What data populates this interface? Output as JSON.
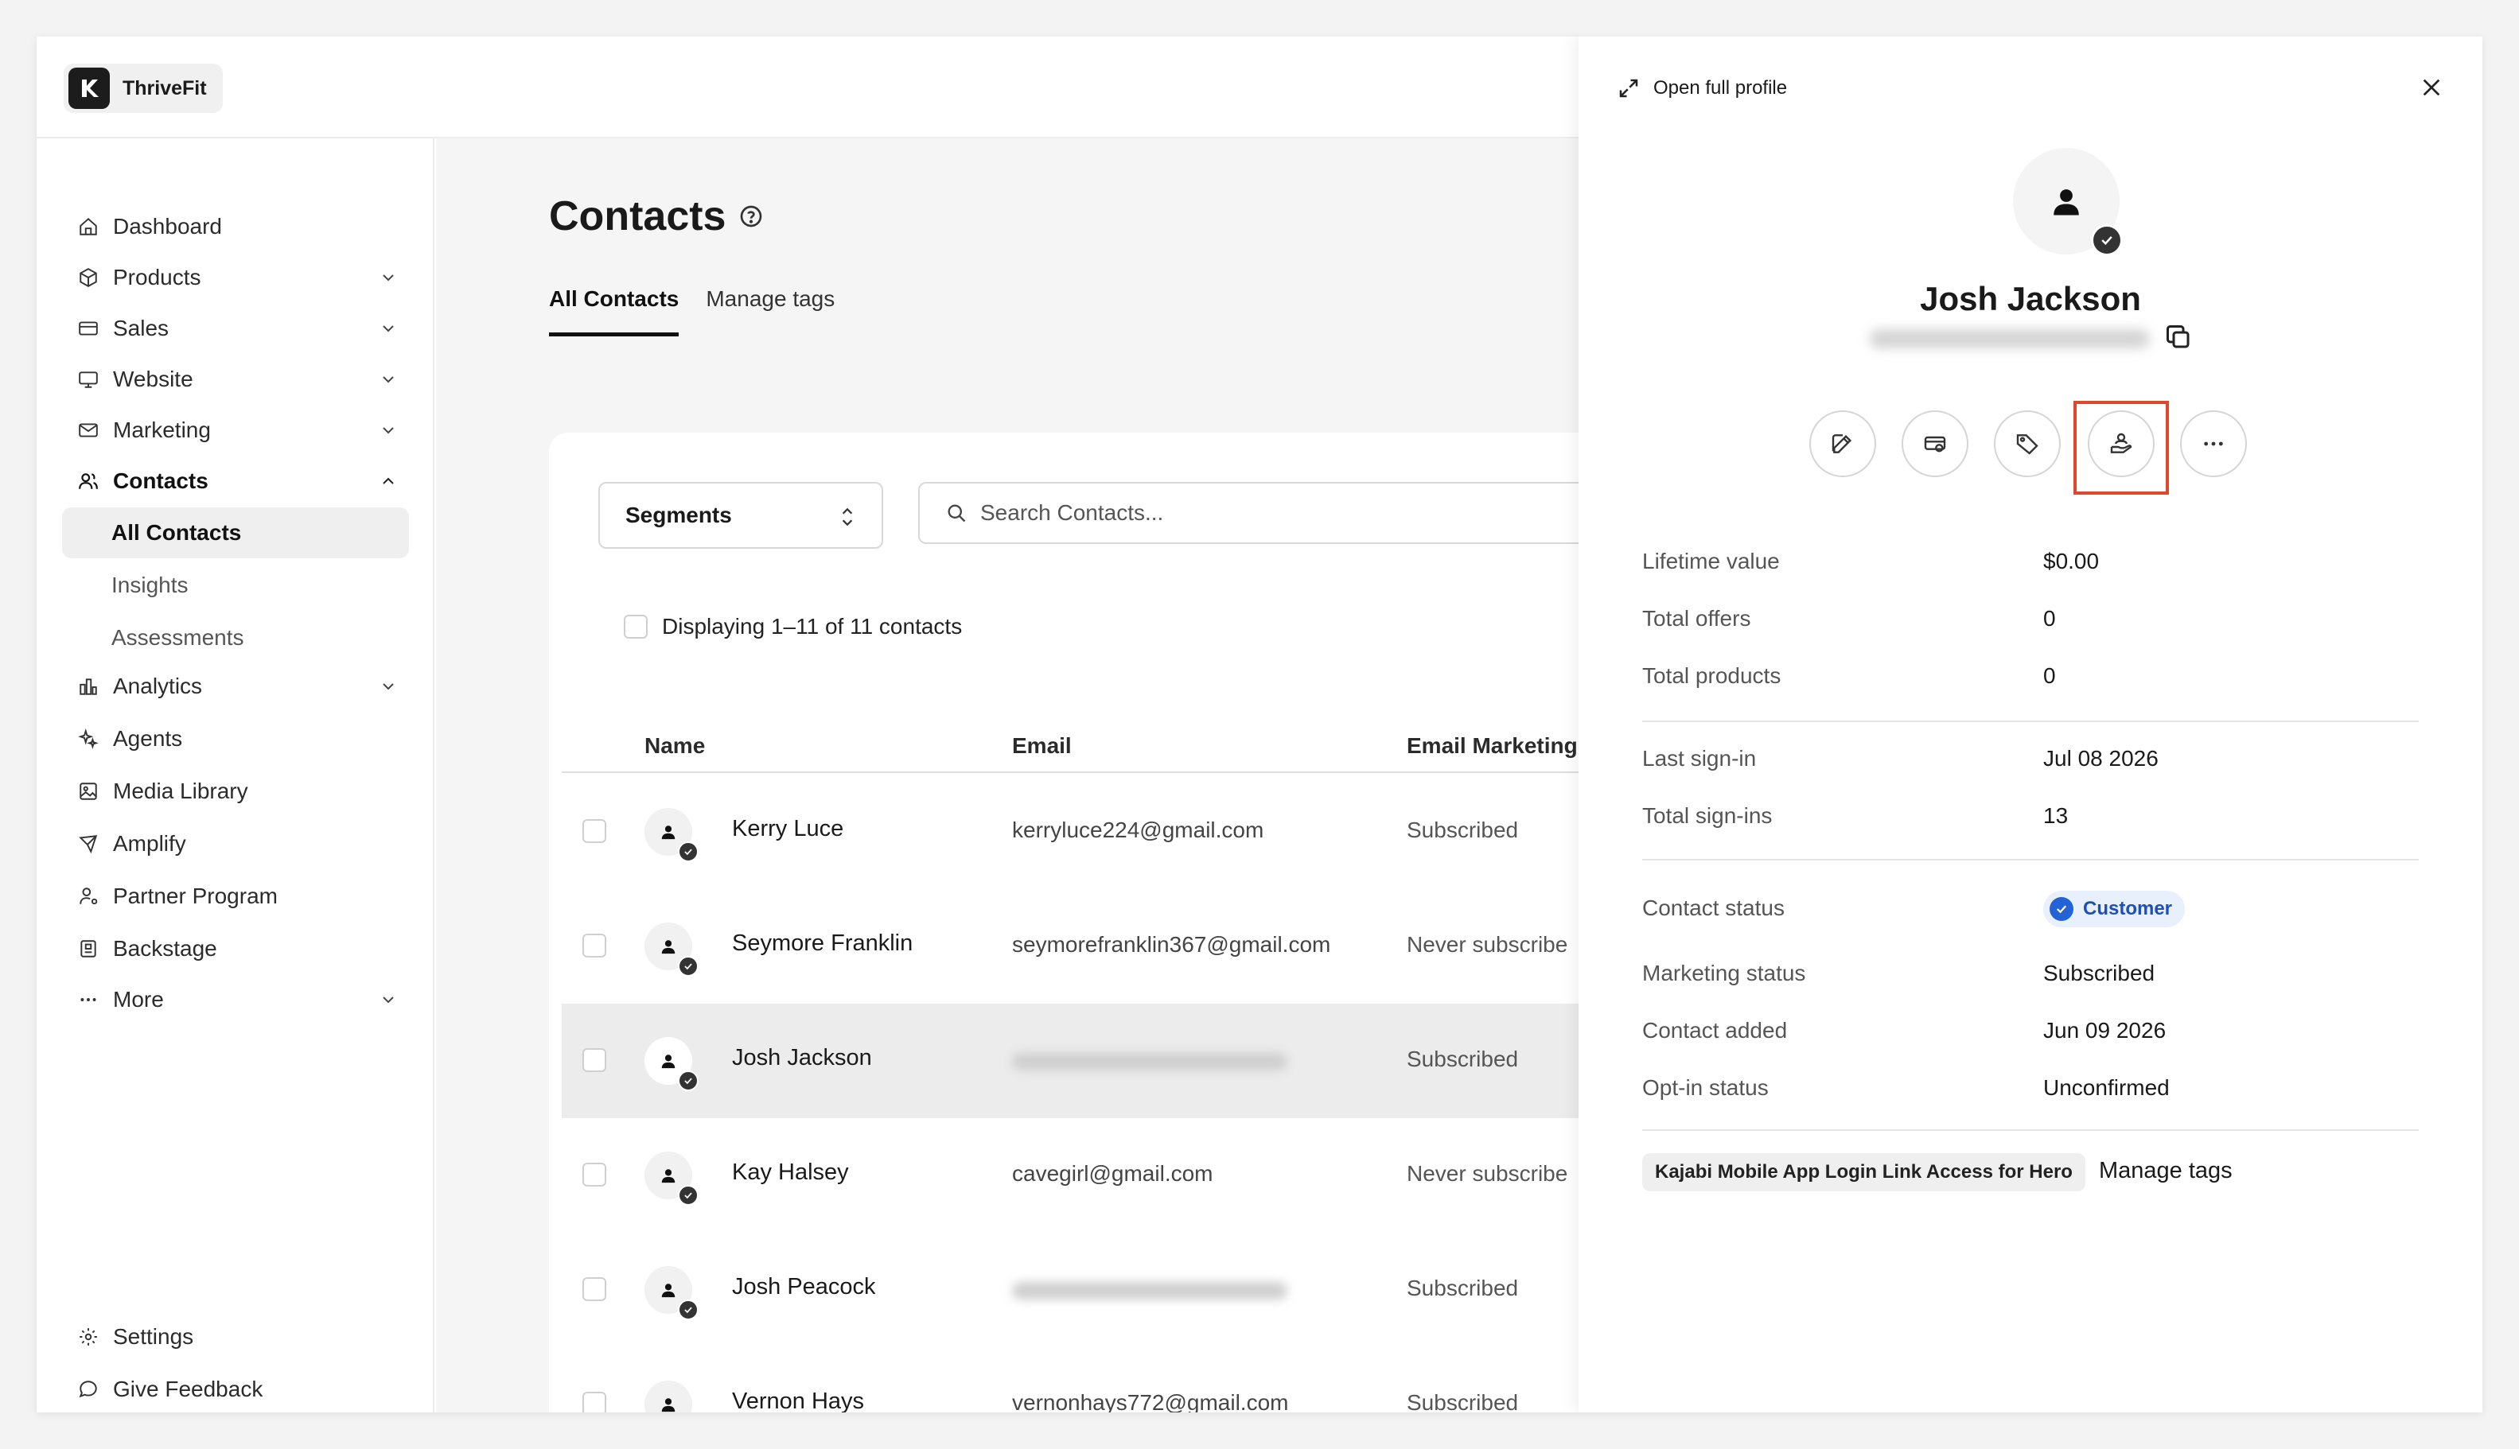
{
  "brand": {
    "name": "ThriveFit"
  },
  "sidebar": {
    "items": [
      {
        "label": "Dashboard",
        "icon": "home-icon",
        "chevron": false
      },
      {
        "label": "Products",
        "icon": "box-icon",
        "chevron": true
      },
      {
        "label": "Sales",
        "icon": "card-icon",
        "chevron": true
      },
      {
        "label": "Website",
        "icon": "monitor-icon",
        "chevron": true
      },
      {
        "label": "Marketing",
        "icon": "mail-icon",
        "chevron": true
      },
      {
        "label": "Contacts",
        "icon": "users-icon",
        "chevron": true,
        "expanded": true
      }
    ],
    "contacts_sub": [
      "All Contacts",
      "Insights",
      "Assessments"
    ],
    "items2": [
      {
        "label": "Analytics",
        "icon": "bar-chart-icon",
        "chevron": true
      },
      {
        "label": "Agents",
        "icon": "sparkle-icon",
        "chevron": false
      },
      {
        "label": "Media Library",
        "icon": "image-icon",
        "chevron": false
      },
      {
        "label": "Amplify",
        "icon": "megaphone-icon",
        "chevron": false
      },
      {
        "label": "Partner Program",
        "icon": "partner-icon",
        "chevron": false
      },
      {
        "label": "Backstage",
        "icon": "backstage-icon",
        "chevron": false
      },
      {
        "label": "More",
        "icon": "more-icon",
        "chevron": true
      }
    ],
    "bottom": [
      {
        "label": "Settings",
        "icon": "gear-icon"
      },
      {
        "label": "Give Feedback",
        "icon": "chat-icon"
      }
    ]
  },
  "main": {
    "title": "Contacts",
    "tabs": [
      "All Contacts",
      "Manage tags"
    ],
    "segments_label": "Segments",
    "search_placeholder": "Search Contacts...",
    "displaying": "Displaying 1–11 of 11 contacts",
    "columns": [
      "Name",
      "Email",
      "Email Marketing"
    ],
    "rows": [
      {
        "name": "Kerry Luce",
        "email": "kerryluce224@gmail.com",
        "marketing": "Subscribed",
        "email_hidden": false
      },
      {
        "name": "Seymore Franklin",
        "email": "seymorefranklin367@gmail.com",
        "marketing": "Never subscribe",
        "email_hidden": false
      },
      {
        "name": "Josh Jackson",
        "email": "",
        "marketing": "Subscribed",
        "email_hidden": true
      },
      {
        "name": "Kay Halsey",
        "email": "cavegirl@gmail.com",
        "marketing": "Never subscribe",
        "email_hidden": false
      },
      {
        "name": "Josh Peacock",
        "email": "",
        "marketing": "Subscribed",
        "email_hidden": true
      },
      {
        "name": "Vernon Hays",
        "email": "vernonhays772@gmail.com",
        "marketing": "Subscribed",
        "email_hidden": false
      }
    ]
  },
  "panel": {
    "open_full_profile": "Open full profile",
    "name": "Josh Jackson",
    "actions": [
      "edit-icon",
      "offer-icon",
      "tag-icon",
      "grant-access-icon",
      "more-icon"
    ],
    "stats": [
      {
        "label": "Lifetime value",
        "value": "$0.00"
      },
      {
        "label": "Total offers",
        "value": "0"
      },
      {
        "label": "Total products",
        "value": "0"
      }
    ],
    "signins": [
      {
        "label": "Last sign-in",
        "value": "Jul 08 2026"
      },
      {
        "label": "Total sign-ins",
        "value": "13"
      }
    ],
    "contact_status_label": "Contact status",
    "contact_status_value": "Customer",
    "details": [
      {
        "label": "Marketing status",
        "value": "Subscribed"
      },
      {
        "label": "Contact added",
        "value": "Jun 09 2026"
      },
      {
        "label": "Opt-in status",
        "value": "Unconfirmed"
      }
    ],
    "tag": "Kajabi Mobile App Login Link Access for Hero",
    "manage_tags": "Manage tags"
  },
  "colors": {
    "accent_blue": "#2463d6",
    "highlight_red": "#e0472f"
  }
}
